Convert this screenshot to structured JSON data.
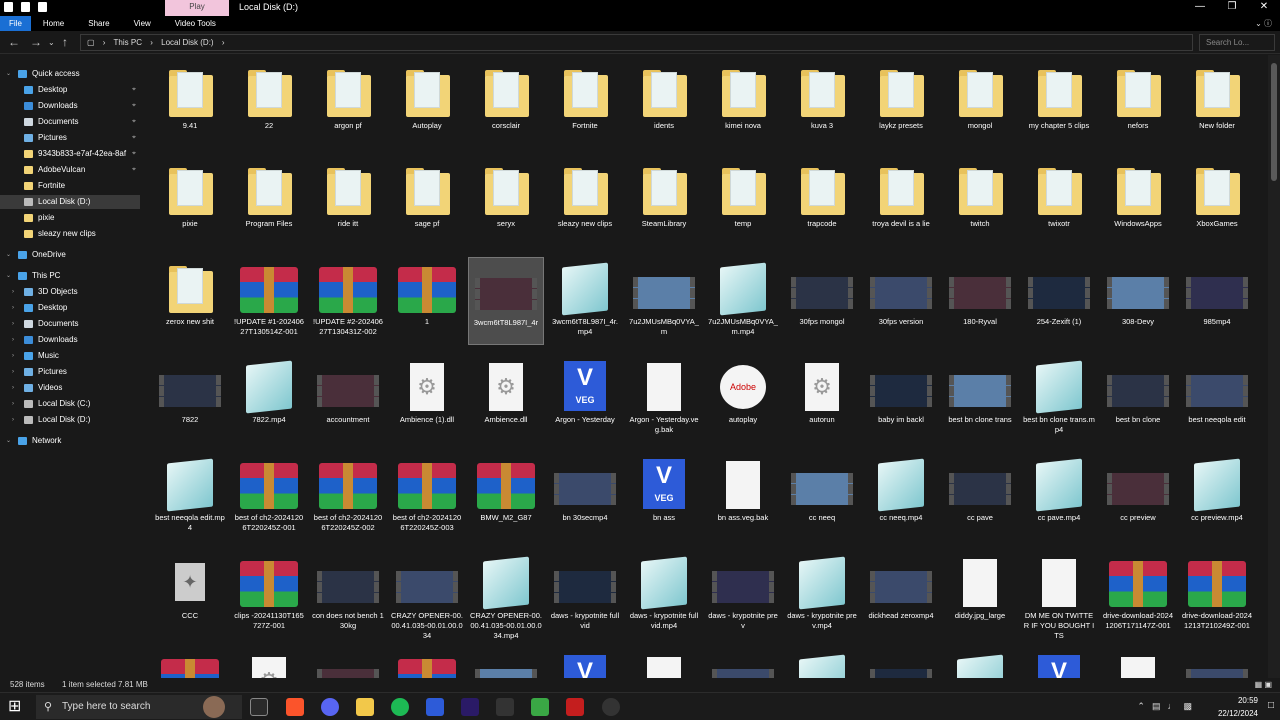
{
  "window": {
    "title": "Local Disk (D:)",
    "context_tab": "Play"
  },
  "ribbon": {
    "tabs": [
      "File",
      "Home",
      "Share",
      "View",
      "Video Tools"
    ]
  },
  "address": {
    "parts": [
      "This PC",
      "Local Disk (D:)"
    ],
    "search_placeholder": "Search Lo..."
  },
  "sidebar": [
    {
      "label": "Quick access",
      "icon": "star-icon",
      "color": "#4aa3e8",
      "level": 0,
      "expand": true
    },
    {
      "label": "Desktop",
      "icon": "desktop-icon",
      "color": "#4aa3e8",
      "level": 1,
      "pinned": true
    },
    {
      "label": "Downloads",
      "icon": "downloads-icon",
      "color": "#3c8dd9",
      "level": 1,
      "pinned": true
    },
    {
      "label": "Documents",
      "icon": "documents-icon",
      "color": "#cfd8e0",
      "level": 1,
      "pinned": true
    },
    {
      "label": "Pictures",
      "icon": "pictures-icon",
      "color": "#6fb0e4",
      "level": 1,
      "pinned": true
    },
    {
      "label": "9343b833-e7af-42ea-8af",
      "icon": "folder-icon",
      "color": "#f2d477",
      "level": 1,
      "pinned": true
    },
    {
      "label": "AdobeVulcan",
      "icon": "folder-icon",
      "color": "#f2d477",
      "level": 1,
      "pinned": true
    },
    {
      "label": "Fortnite",
      "icon": "folder-icon",
      "color": "#f2d477",
      "level": 1
    },
    {
      "label": "Local Disk (D:)",
      "icon": "drive-icon",
      "color": "#bbbbbb",
      "level": 1,
      "selected": true
    },
    {
      "label": "pixie",
      "icon": "folder-icon",
      "color": "#f2d477",
      "level": 1
    },
    {
      "label": "sleazy new clips",
      "icon": "folder-icon",
      "color": "#f2d477",
      "level": 1
    },
    {
      "label": "OneDrive",
      "icon": "cloud-icon",
      "color": "#4aa3e8",
      "level": 0,
      "expand": true
    },
    {
      "label": "This PC",
      "icon": "pc-icon",
      "color": "#4aa3e8",
      "level": 0,
      "expand": true
    },
    {
      "label": "3D Objects",
      "icon": "3d-objects-icon",
      "color": "#6fb0e4",
      "level": 1,
      "expand": true
    },
    {
      "label": "Desktop",
      "icon": "desktop-icon",
      "color": "#4aa3e8",
      "level": 1,
      "expand": true
    },
    {
      "label": "Documents",
      "icon": "documents-icon",
      "color": "#cfd8e0",
      "level": 1,
      "expand": true
    },
    {
      "label": "Downloads",
      "icon": "downloads-icon",
      "color": "#3c8dd9",
      "level": 1,
      "expand": true
    },
    {
      "label": "Music",
      "icon": "music-icon",
      "color": "#4aa3e8",
      "level": 1,
      "expand": true
    },
    {
      "label": "Pictures",
      "icon": "pictures-icon",
      "color": "#6fb0e4",
      "level": 1,
      "expand": true
    },
    {
      "label": "Videos",
      "icon": "videos-icon",
      "color": "#6fb0e4",
      "level": 1,
      "expand": true
    },
    {
      "label": "Local Disk (C:)",
      "icon": "drive-icon",
      "color": "#bbbbbb",
      "level": 1,
      "expand": true
    },
    {
      "label": "Local Disk (D:)",
      "icon": "drive-icon",
      "color": "#bbbbbb",
      "level": 1,
      "expand": true
    },
    {
      "label": "Network",
      "icon": "network-icon",
      "color": "#4aa3e8",
      "level": 0,
      "expand": true
    }
  ],
  "files": [
    [
      "9.41",
      "folder"
    ],
    [
      "22",
      "folder"
    ],
    [
      "argon pf",
      "folder"
    ],
    [
      "Autoplay",
      "folder"
    ],
    [
      "corsclair",
      "folder"
    ],
    [
      "Fortnite",
      "folder"
    ],
    [
      "idents",
      "folder"
    ],
    [
      "kimei nova",
      "folder"
    ],
    [
      "kuva 3",
      "folder"
    ],
    [
      "laykz presets",
      "folder"
    ],
    [
      "mongol",
      "folder"
    ],
    [
      "my chapter 5 clips",
      "folder"
    ],
    [
      "nefors",
      "folder"
    ],
    [
      "New folder",
      "folder"
    ],
    [
      "pixie",
      "folder"
    ],
    [
      "Program Files",
      "folder"
    ],
    [
      "ride itt",
      "folder"
    ],
    [
      "sage pf",
      "folder"
    ],
    [
      "seryx",
      "folder"
    ],
    [
      "sleazy new clips",
      "folder"
    ],
    [
      "SteamLibrary",
      "folder"
    ],
    [
      "temp",
      "folder"
    ],
    [
      "trapcode",
      "folder"
    ],
    [
      "troya devil is a lie",
      "folder"
    ],
    [
      "twitch",
      "folder"
    ],
    [
      "twixotr",
      "folder"
    ],
    [
      "WindowsApps",
      "folder"
    ],
    [
      "XboxGames",
      "folder"
    ],
    [
      "zerox new shit",
      "folder"
    ],
    [
      "!UPDATE #1-20240627T130514Z-001",
      "winrar"
    ],
    [
      "!UPDATE #2-20240627T130431Z-002",
      "winrar"
    ],
    [
      "1",
      "winrar"
    ],
    [
      "3wcm6tT8L987I_4r",
      "video"
    ],
    [
      "3wcm6tT8L987I_4r.mp4",
      "notepad"
    ],
    [
      "7u2JMUsMBq0VYA_m",
      "video"
    ],
    [
      "7u2JMUsMBq0VYA_m.mp4",
      "notepad"
    ],
    [
      "30fps mongol",
      "video"
    ],
    [
      "30fps version",
      "video"
    ],
    [
      "180-Ryval",
      "video"
    ],
    [
      "254-Zexift (1)",
      "video"
    ],
    [
      "308-Devy",
      "video"
    ],
    [
      "985mp4",
      "video"
    ],
    [
      "7822",
      "video"
    ],
    [
      "7822.mp4",
      "notepad"
    ],
    [
      "accountment",
      "video"
    ],
    [
      "Ambience (1).dll",
      "gear"
    ],
    [
      "Ambience.dll",
      "gear"
    ],
    [
      "Argon - Yesterday",
      "veg"
    ],
    [
      "Argon - Yesterday.veg.bak",
      "doc"
    ],
    [
      "autoplay",
      "adobe"
    ],
    [
      "autorun",
      "gear"
    ],
    [
      "baby im backl",
      "video"
    ],
    [
      "best bn clone trans",
      "video"
    ],
    [
      "best bn clone trans.mp4",
      "notepad"
    ],
    [
      "best bn clone",
      "video"
    ],
    [
      "best neeqola edit",
      "video"
    ],
    [
      "best neeqola edit.mp4",
      "notepad"
    ],
    [
      "best of ch2-20241206T220245Z-001",
      "winrar"
    ],
    [
      "best of ch2-20241206T220245Z-002",
      "winrar"
    ],
    [
      "best of ch2-20241206T220245Z-003",
      "winrar"
    ],
    [
      "BMW_M2_G87",
      "winrar"
    ],
    [
      "bn 30secmp4",
      "video"
    ],
    [
      "bn ass",
      "veg"
    ],
    [
      "bn ass.veg.bak",
      "doc"
    ],
    [
      "cc neeq",
      "video"
    ],
    [
      "cc neeq.mp4",
      "notepad"
    ],
    [
      "cc pave",
      "video"
    ],
    [
      "cc pave.mp4",
      "notepad"
    ],
    [
      "cc preview",
      "video"
    ],
    [
      "cc preview.mp4",
      "notepad"
    ],
    [
      "CCC",
      "ccc"
    ],
    [
      "clips -20241130T165727Z-001",
      "winrar"
    ],
    [
      "con does not bench 130kg",
      "video"
    ],
    [
      "CRAZY OPENER-00.00.41.035-00.01.00.034",
      "video"
    ],
    [
      "CRAZY OPENER-00.00.41.035-00.01.00.034.mp4",
      "notepad"
    ],
    [
      "daws - krypotnite full vid",
      "video"
    ],
    [
      "daws - krypotnite full vid.mp4",
      "notepad"
    ],
    [
      "daws - krypotnite prev",
      "video"
    ],
    [
      "daws - krypotnite prev.mp4",
      "notepad"
    ],
    [
      "dickhead zeroxmp4",
      "video"
    ],
    [
      "diddy.jpg_large",
      "doc"
    ],
    [
      "DM ME ON TWITTER IF YOU BOUGHT ITS",
      "doc"
    ],
    [
      "drive-download-20241206T171147Z-001",
      "winrar"
    ],
    [
      "drive-download-20241213T210249Z-001",
      "winrar"
    ],
    [
      "",
      "winrar"
    ],
    [
      "",
      "gear"
    ],
    [
      "",
      "video"
    ],
    [
      "",
      "winrar"
    ],
    [
      "",
      "video"
    ],
    [
      "",
      "veg"
    ],
    [
      "",
      "doc"
    ],
    [
      "",
      "video"
    ],
    [
      "",
      "notepad"
    ],
    [
      "",
      "video"
    ],
    [
      "",
      "notepad"
    ],
    [
      "",
      "veg"
    ],
    [
      "",
      "doc"
    ],
    [
      "",
      "video"
    ]
  ],
  "selected_index": 32,
  "status": {
    "count": "528 items",
    "selected": "1 item selected  7.81 MB"
  },
  "taskbar": {
    "search": "Type here to search",
    "time": "20:59",
    "date": "22/12/2024"
  }
}
